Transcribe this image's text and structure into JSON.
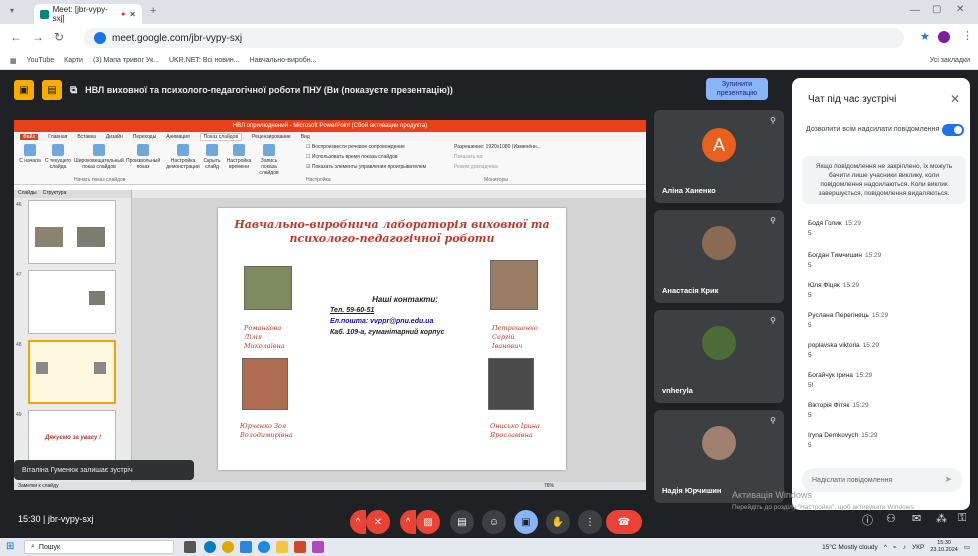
{
  "browser": {
    "tab_title": "Meet: [jbr-vypy-sxj]",
    "url": "meet.google.com/jbr-vypy-sxj",
    "bookmarks": [
      "YouTube",
      "Карти",
      "(3) Мапа тривог Ук...",
      "UKR.NET: Всі новин...",
      "Навчально-виробн..."
    ],
    "bookmarks_right": "Усі закладки",
    "new_tab": "+"
  },
  "meet": {
    "presenting_title": "НВЛ виховної та психолого-педагогічної роботи ПНУ (Ви (показуєте презентацію))",
    "stop_presenting": "Зупинити презентацію",
    "meeting_code": "15:30  |  jbr-vypy-sxj",
    "toast": "Віталіна Гуменюк залишає зустріч",
    "participants": [
      {
        "name": "Аліна Ханенко",
        "initial": "A"
      },
      {
        "name": "Анастасія Крик"
      },
      {
        "name": "vnheryla"
      },
      {
        "name": "Надія Юрчишин"
      }
    ]
  },
  "ppt": {
    "window_title": "НВЛ оприлюднений - Microsoft PowerPoint (Сбой активации продукта)",
    "tabs": [
      "Файл",
      "Главная",
      "Вставка",
      "Дизайн",
      "Переходы",
      "Анимация",
      "Показ слайдов",
      "Рецензирование",
      "Вид"
    ],
    "active_tab": "Показ слайдов",
    "ribbon_buttons": [
      "С начала",
      "С текущего слайда",
      "Широковещательный показ слайдов",
      "Произвольный показ",
      "Настройка демонстрации",
      "Скрыть слайд",
      "Настройка времени",
      "Запись показа слайдов"
    ],
    "checks": [
      "Воспроизвести речевое сопровождение",
      "Использовать время показа слайдов",
      "Показать элементы управления проигрывателем"
    ],
    "resolution": "Разрешение: 1920x1080 (Изменённ...",
    "show_on": "Показать на:",
    "presenter_view": "Режим докладчика",
    "group_start": "Начать показ слайдов",
    "group_setup": "Настройка",
    "group_monitors": "Мониторы",
    "side_tabs": [
      "Слайды",
      "Структура"
    ],
    "thumb_numbers": [
      "46",
      "47",
      "48",
      "49"
    ],
    "thumb_last_text": "Дякуємо за увагу !",
    "status_left": "Заметки к слайду",
    "zoom": "76%"
  },
  "slide": {
    "title": "Навчально-виробнича лабораторія виховної та психолого-педагогічної роботи",
    "contacts_heading": "Наші контакти:",
    "phone": "Тел. 59-60-51",
    "email": "Ел.пошта: vvppr@pnu.edu.ua",
    "office": "Каб. 109-а, гуманітарний корпус",
    "people": [
      "Романкова Лілія Миколаївна",
      "Петрошенко Сергій Іванович",
      "Юрченко Зоя Володимирівна",
      "Онисько Ірина Ярославівна"
    ]
  },
  "chat": {
    "title": "Чат під час зустрічі",
    "allow_label": "Дозволити всім надсилати повідомлення",
    "note": "Якщо повідомлення не закріплено, їх можуть бачити лише учасники виклику, коли повідомлення надсилаються. Коли виклик завершується, повідомлення видаляються.",
    "messages": [
      {
        "author": "Бодя Голик",
        "time": "15:29",
        "text": "5"
      },
      {
        "author": "Богдан Тимчишин",
        "time": "15:29",
        "text": "5"
      },
      {
        "author": "Юля Фіцяк",
        "time": "15:29",
        "text": "5"
      },
      {
        "author": "Руслана Перегінець",
        "time": "15:29",
        "text": "5"
      },
      {
        "author": "poplavska viktoria",
        "time": "15:29",
        "text": "5"
      },
      {
        "author": "Богайчук Ірина",
        "time": "15:29",
        "text": "5!"
      },
      {
        "author": "Вікторія Фітяк",
        "time": "15:29",
        "text": "5"
      },
      {
        "author": "Iryna Demkovych",
        "time": "15:29",
        "text": "5"
      }
    ],
    "send_placeholder": "Надіслати повідомлення"
  },
  "windows": {
    "activation_title": "Активація Windows",
    "activation_sub": "Перейдіть до розділу \"Настройки\", щоб активувати Windows.",
    "search": "Пошук",
    "weather": "15°C  Mostly cloudy",
    "lang": "УКР",
    "time": "15:30",
    "date": "23.10.2024"
  },
  "colors": {
    "accent": "#1a73e8",
    "end_call": "#ea4335",
    "ppt_red": "#e8411a",
    "slide_title": "#c0392b"
  }
}
